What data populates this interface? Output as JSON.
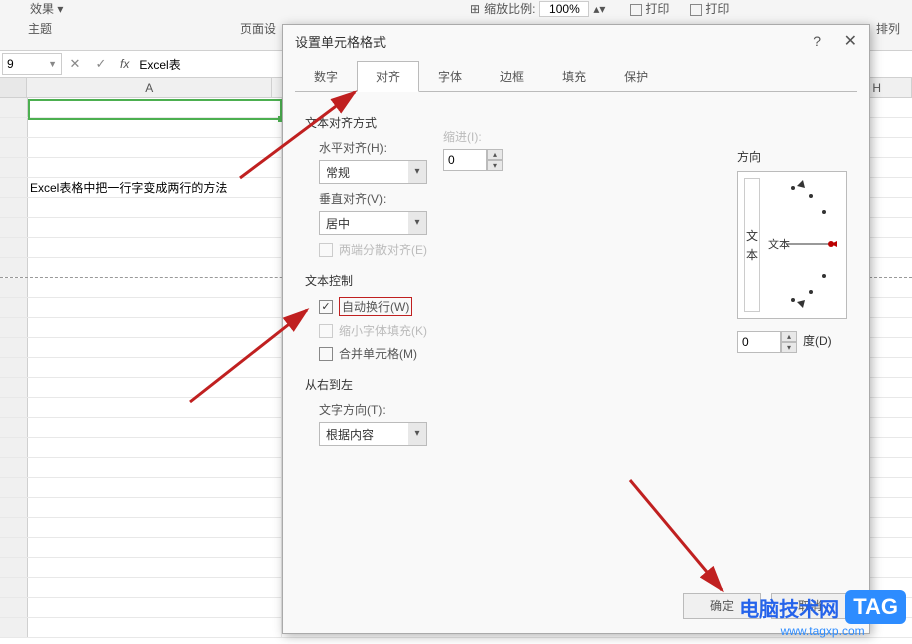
{
  "ribbon": {
    "effect": "效果",
    "theme": "主题",
    "page_setup": "页面设",
    "zoom_label": "缩放比例:",
    "zoom_value": "100%",
    "print1": "打印",
    "print2": "打印",
    "arrange": "排列"
  },
  "formula_bar": {
    "name_box": "9",
    "fx": "fx",
    "value": "Excel表"
  },
  "columns": {
    "A": "A",
    "H": "H"
  },
  "cell_content": "Excel表格中把一行字变成两行的方法",
  "dialog": {
    "title": "设置单元格格式",
    "help": "?",
    "close": "✕",
    "tabs": {
      "number": "数字",
      "align": "对齐",
      "font": "字体",
      "border": "边框",
      "fill": "填充",
      "protect": "保护"
    },
    "text_align_section": "文本对齐方式",
    "h_align_label": "水平对齐(H):",
    "h_align_value": "常规",
    "indent_label": "缩进(I):",
    "indent_value": "0",
    "v_align_label": "垂直对齐(V):",
    "v_align_value": "居中",
    "justify_distributed": "两端分散对齐(E)",
    "text_control_section": "文本控制",
    "wrap_text": "自动换行(W)",
    "shrink_to_fit": "缩小字体填充(K)",
    "merge_cells": "合并单元格(M)",
    "rtl_section": "从右到左",
    "text_dir_label": "文字方向(T):",
    "text_dir_value": "根据内容",
    "orientation_label": "方向",
    "vert_char1": "文",
    "vert_char2": "本",
    "arc_text": "文本",
    "degree_value": "0",
    "degree_label": "度(D)",
    "ok": "确定",
    "cancel": "取消"
  },
  "watermark": {
    "brand": "电脑技术网",
    "tag": "TAG",
    "url": "www.tagxp.com"
  }
}
